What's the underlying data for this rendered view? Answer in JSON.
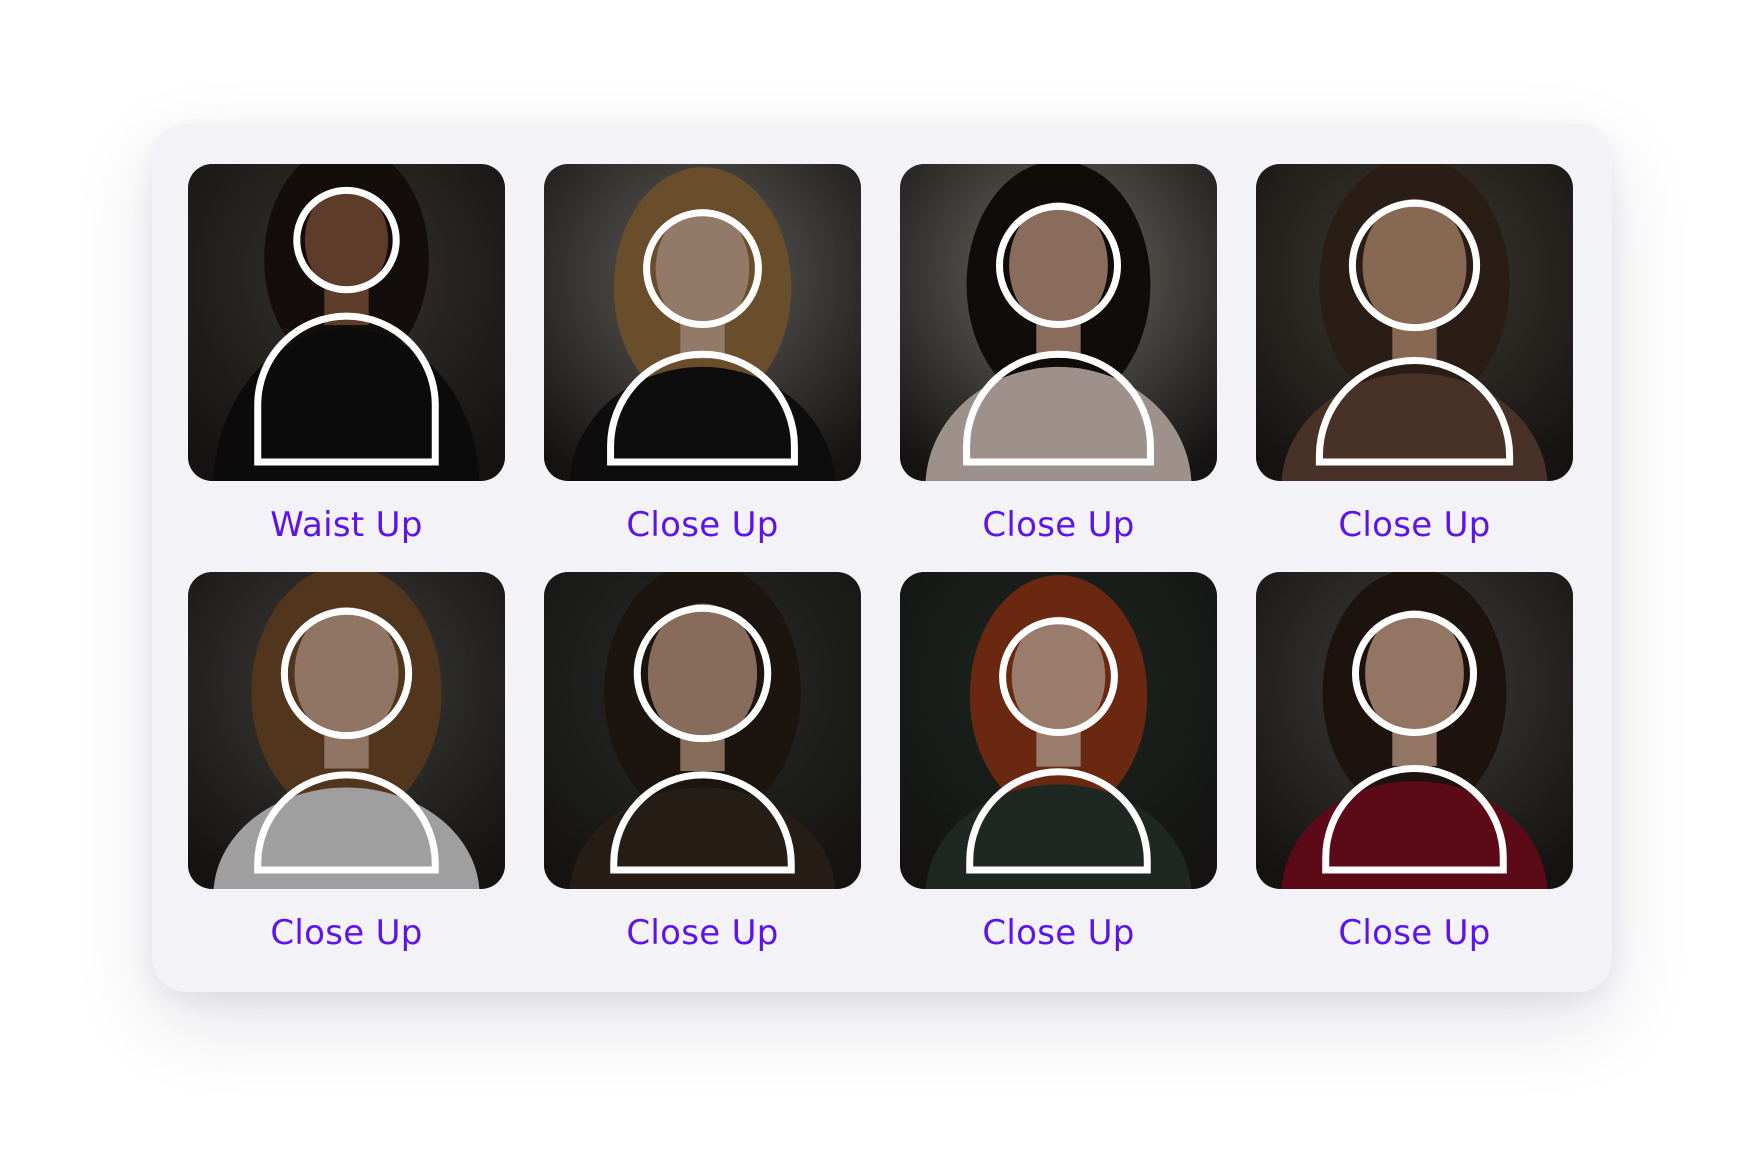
{
  "accent_color": "#5b14ee",
  "outline_icon": "person-outline-icon",
  "tiles": [
    {
      "label": "Waist Up",
      "bg": "#4f4a45",
      "hair": "#1c1613",
      "skin": "#8a5a3e",
      "shirt": "#111111",
      "head_y": 0.24,
      "head_r": 0.16,
      "body_top": 0.48,
      "body_w": 0.56
    },
    {
      "label": "Close Up",
      "bg": "#8e8c87",
      "hair": "#9c7440",
      "skin": "#d9b39a",
      "shirt": "#141414",
      "head_y": 0.33,
      "head_r": 0.18,
      "body_top": 0.6,
      "body_w": 0.58
    },
    {
      "label": "Close Up",
      "bg": "#a19d95",
      "hair": "#17120f",
      "skin": "#caa088",
      "shirt": "#e9d4cc",
      "head_y": 0.32,
      "head_r": 0.19,
      "body_top": 0.6,
      "body_w": 0.58
    },
    {
      "label": "Close Up",
      "bg": "#5e564c",
      "hair": "#3d2c20",
      "skin": "#c79a7a",
      "shirt": "#6b4a3a",
      "head_y": 0.32,
      "head_r": 0.2,
      "body_top": 0.62,
      "body_w": 0.6
    },
    {
      "label": "Close Up",
      "bg": "#5a5a57",
      "hair": "#7a4f2c",
      "skin": "#d5ad95",
      "shirt": "#eaeaea",
      "head_y": 0.32,
      "head_r": 0.2,
      "body_top": 0.64,
      "body_w": 0.56
    },
    {
      "label": "Close Up",
      "bg": "#3d413f",
      "hair": "#2a1e17",
      "skin": "#c79f86",
      "shirt": "#3a2b23",
      "head_y": 0.32,
      "head_r": 0.21,
      "body_top": 0.64,
      "body_w": 0.56
    },
    {
      "label": "Close Up",
      "bg": "#2b3a33",
      "hair": "#9c3b18",
      "skin": "#e3b7a0",
      "shirt": "#2e3a34",
      "head_y": 0.33,
      "head_r": 0.18,
      "body_top": 0.63,
      "body_w": 0.56
    },
    {
      "label": "Close Up",
      "bg": "#5f5a55",
      "hair": "#2a1c16",
      "skin": "#d8ad93",
      "shirt": "#8a1024",
      "head_y": 0.32,
      "head_r": 0.19,
      "body_top": 0.62,
      "body_w": 0.56
    }
  ]
}
